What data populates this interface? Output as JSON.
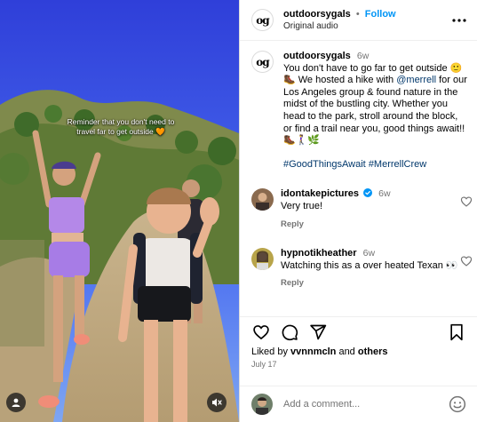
{
  "media": {
    "overlay_caption": "Reminder that you don't need to travel far to get outside 🧡",
    "user_icon": "user-circle-icon",
    "mute_icon": "speaker-muted-icon"
  },
  "header": {
    "avatar_text": "og",
    "username": "outdoorsygals",
    "separator": "•",
    "follow_label": "Follow",
    "subtitle": "Original audio",
    "more_icon": "more-horizontal-icon"
  },
  "caption": {
    "avatar_text": "og",
    "username": "outdoorsygals",
    "time": "6w",
    "text_before_mention": "You don't have to go far to get outside 🙂🥾 We hosted a hike with ",
    "mention": "@merrell",
    "text_after_mention": " for our Los Angeles group & found nature in the midst of the bustling city. Whether you head to the park, stroll around the block, or find a trail near you, good things await!! 🥾🚶‍♀️🌿",
    "hashtag_1": "#GoodThingsAwait",
    "hashtag_2": "#MerrellCrew"
  },
  "comments": [
    {
      "username": "idontakepictures",
      "verified": true,
      "time": "6w",
      "text": "Very true!",
      "reply_label": "Reply"
    },
    {
      "username": "hypnotikheather",
      "verified": false,
      "time": "6w",
      "text": "Watching this as a over heated Texan 👀",
      "reply_label": "Reply"
    }
  ],
  "actions": {
    "like_icon": "heart-icon",
    "comment_icon": "comment-bubble-icon",
    "share_icon": "send-icon",
    "save_icon": "bookmark-icon"
  },
  "likes": {
    "prefix": "Liked by ",
    "user": "vvnnmcln",
    "middle": " and ",
    "others": "others"
  },
  "post_date": "July 17",
  "add_comment": {
    "placeholder": "Add a comment...",
    "emoji_icon": "smiley-icon"
  },
  "colors": {
    "accent": "#0095f6",
    "link": "#00376b",
    "muted": "#737373",
    "verified": "#0095f6"
  }
}
